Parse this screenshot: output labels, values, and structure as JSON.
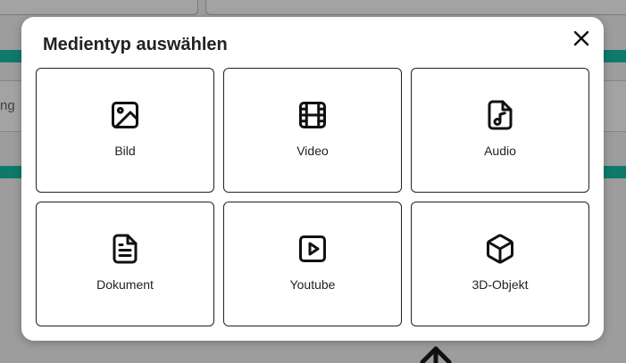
{
  "background": {
    "field_text": "ng"
  },
  "modal": {
    "title": "Medientyp auswählen",
    "close_icon": "close-icon",
    "options": [
      {
        "label": "Bild",
        "icon": "image-icon"
      },
      {
        "label": "Video",
        "icon": "film-icon"
      },
      {
        "label": "Audio",
        "icon": "audio-file-icon"
      },
      {
        "label": "Dokument",
        "icon": "document-icon"
      },
      {
        "label": "Youtube",
        "icon": "play-icon"
      },
      {
        "label": "3D-Objekt",
        "icon": "cube-icon"
      }
    ]
  },
  "colors": {
    "accent_teal": "#0f7a6c",
    "overlay": "#9d9d9d",
    "text": "#222222"
  }
}
